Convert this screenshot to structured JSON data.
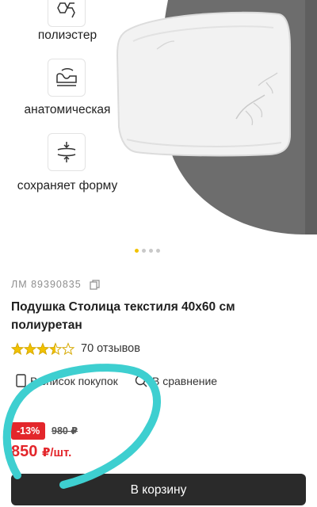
{
  "features": [
    {
      "icon": "honeycomb-icon",
      "label": "полиэстер"
    },
    {
      "icon": "anatomic-icon",
      "label": "анатомическая"
    },
    {
      "icon": "compress-icon",
      "label": "сохраняет форму"
    }
  ],
  "gallery": {
    "slides": 4,
    "active_index": 0,
    "accent": "#f2c200"
  },
  "product": {
    "sku": "ЛМ 89390835",
    "title": "Подушка Столица текстиля 40х60 см полиуретан",
    "rating": 3.5,
    "reviews": "70 отзывов"
  },
  "actions": {
    "shopping_list": "В список покупок",
    "compare": "В сравнение"
  },
  "pricing": {
    "discount": "-13%",
    "old_price": "980 ₽",
    "price": "850",
    "price_unit": "₽/шт."
  },
  "cart_button": "В корзину",
  "colors": {
    "sale": "#e3262b",
    "button": "#2a2a2a",
    "annotation": "#3ecfd0"
  }
}
